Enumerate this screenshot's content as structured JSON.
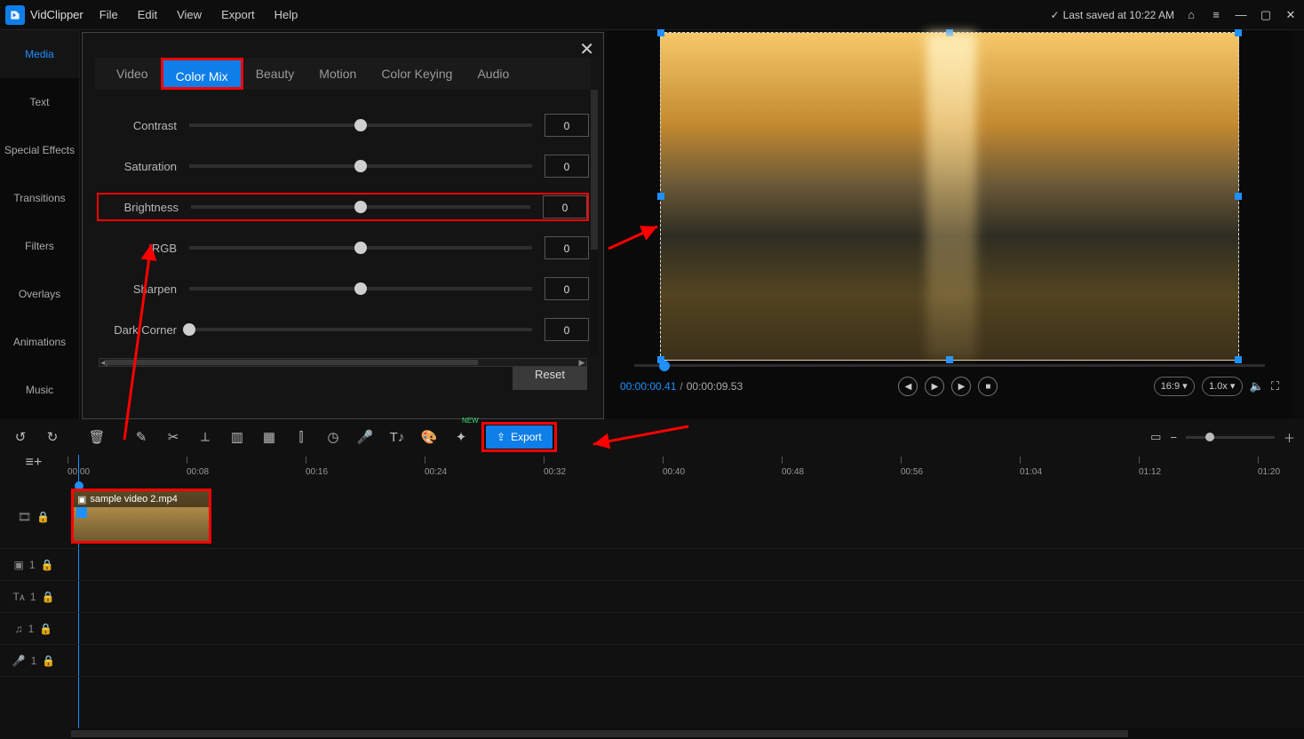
{
  "app": {
    "name": "VidClipper"
  },
  "menu": [
    "File",
    "Edit",
    "View",
    "Export",
    "Help"
  ],
  "status": {
    "saved": "Last saved at 10:22 AM"
  },
  "sidebar": [
    "Media",
    "Text",
    "Special Effects",
    "Transitions",
    "Filters",
    "Overlays",
    "Animations",
    "Music"
  ],
  "editor": {
    "tabs": [
      "Video",
      "Color Mix",
      "Beauty",
      "Motion",
      "Color Keying",
      "Audio"
    ],
    "activeTab": 1,
    "sliders": [
      {
        "label": "Contrast",
        "value": "0",
        "pos": 50
      },
      {
        "label": "Saturation",
        "value": "0",
        "pos": 50
      },
      {
        "label": "Brightness",
        "value": "0",
        "pos": 50,
        "highlight": true
      },
      {
        "label": "RGB",
        "value": "0",
        "pos": 50
      },
      {
        "label": "Sharpen",
        "value": "0",
        "pos": 50
      },
      {
        "label": "Dark Corner",
        "value": "0",
        "pos": 0
      }
    ],
    "reset": "Reset"
  },
  "preview": {
    "current": "00:00:00.41",
    "total": "00:00:09.53",
    "aspect": "16:9",
    "speed": "1.0x"
  },
  "toolstrip": {
    "export": "Export"
  },
  "timeline": {
    "ticks": [
      "00:00",
      "00:08",
      "00:16",
      "00:24",
      "00:32",
      "00:40",
      "00:48",
      "00:56",
      "01:04",
      "01:12",
      "01:20"
    ],
    "clip": {
      "label": "sample video 2.mp4"
    }
  }
}
